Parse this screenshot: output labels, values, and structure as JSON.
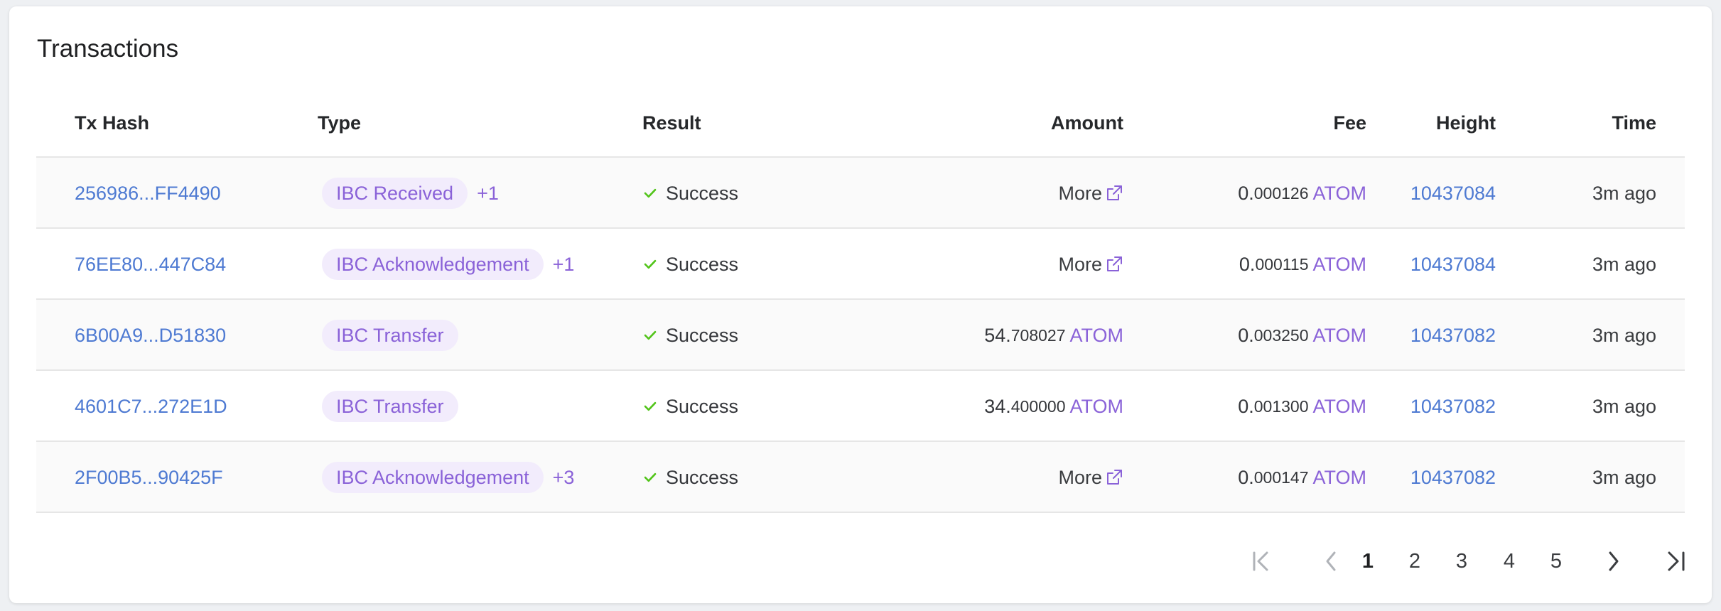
{
  "title": "Transactions",
  "columns": {
    "hash": "Tx Hash",
    "type": "Type",
    "result": "Result",
    "amount": "Amount",
    "fee": "Fee",
    "height": "Height",
    "time": "Time"
  },
  "rows": [
    {
      "hash": "256986...FF4490",
      "type": "IBC Received",
      "extra": "+1",
      "result": "Success",
      "amount_more": "More",
      "fee_int": "0.",
      "fee_dec": "000126",
      "fee_unit": "ATOM",
      "height": "10437084",
      "time": "3m ago"
    },
    {
      "hash": "76EE80...447C84",
      "type": "IBC Acknowledgement",
      "extra": "+1",
      "result": "Success",
      "amount_more": "More",
      "fee_int": "0.",
      "fee_dec": "000115",
      "fee_unit": "ATOM",
      "height": "10437084",
      "time": "3m ago"
    },
    {
      "hash": "6B00A9...D51830",
      "type": "IBC Transfer",
      "result": "Success",
      "amount_int": "54.",
      "amount_dec": "708027",
      "amount_unit": "ATOM",
      "fee_int": "0.",
      "fee_dec": "003250",
      "fee_unit": "ATOM",
      "height": "10437082",
      "time": "3m ago"
    },
    {
      "hash": "4601C7...272E1D",
      "type": "IBC Transfer",
      "result": "Success",
      "amount_int": "34.",
      "amount_dec": "400000",
      "amount_unit": "ATOM",
      "fee_int": "0.",
      "fee_dec": "001300",
      "fee_unit": "ATOM",
      "height": "10437082",
      "time": "3m ago"
    },
    {
      "hash": "2F00B5...90425F",
      "type": "IBC Acknowledgement",
      "extra": "+3",
      "result": "Success",
      "amount_more": "More",
      "fee_int": "0.",
      "fee_dec": "000147",
      "fee_unit": "ATOM",
      "height": "10437082",
      "time": "3m ago"
    }
  ],
  "pagination": {
    "pages": [
      "1",
      "2",
      "3",
      "4",
      "5"
    ],
    "current": "1",
    "icons": {
      "first": "first-page-icon",
      "prev": "chevron-left-icon",
      "next": "chevron-right-icon",
      "last": "last-page-icon"
    }
  },
  "colors": {
    "link": "#4e7ad2",
    "accent": "#8a62d8",
    "pill_bg": "#f2ecfc",
    "success": "#52c41a"
  }
}
